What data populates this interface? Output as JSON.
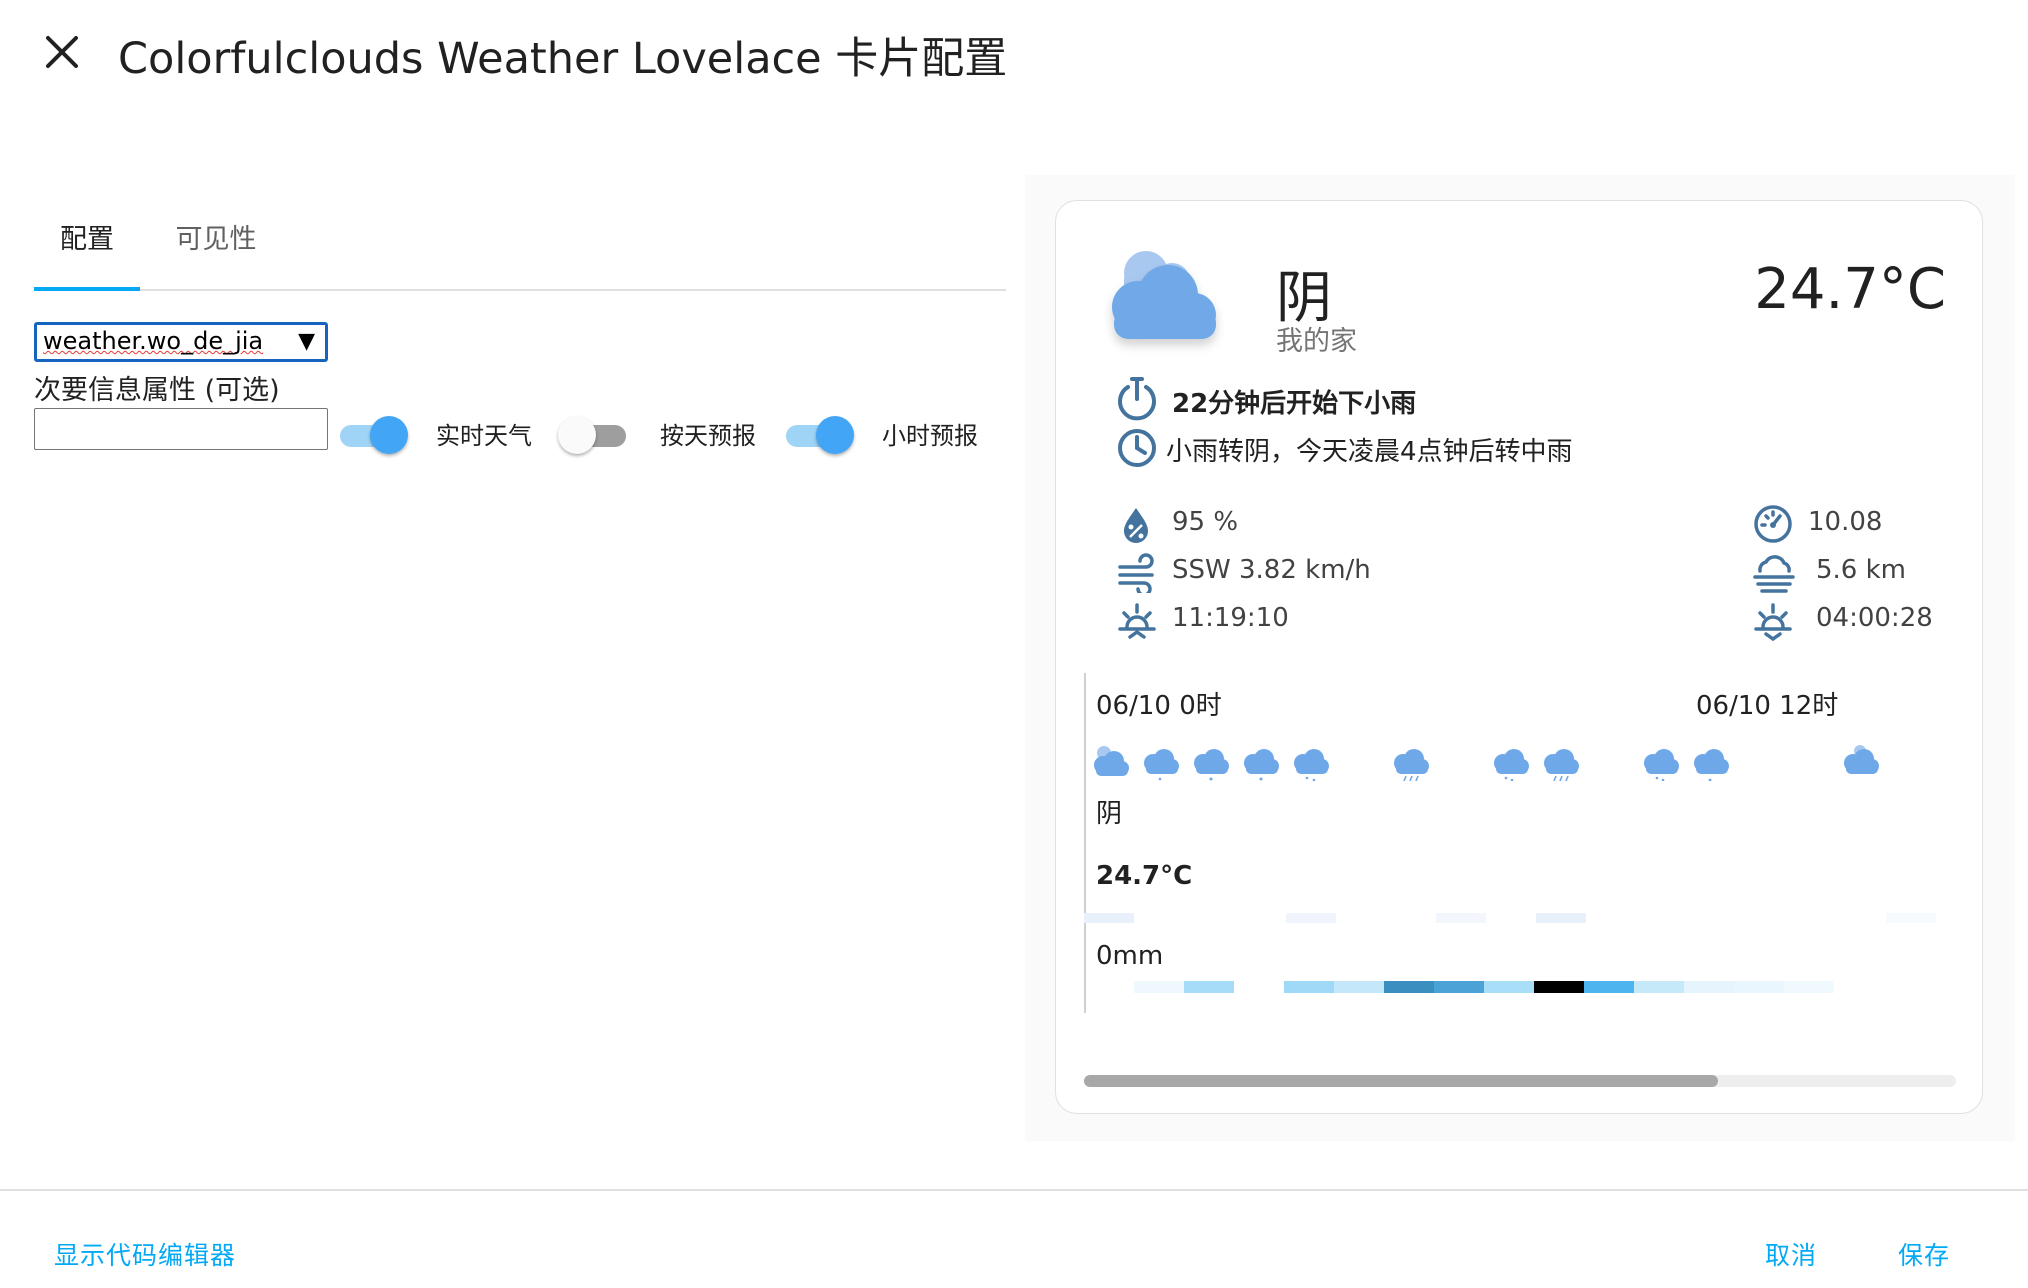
{
  "dialog": {
    "title": "Colorfulclouds Weather Lovelace 卡片配置",
    "close_icon": "close-icon"
  },
  "tabs": [
    {
      "label": "配置",
      "active": true
    },
    {
      "label": "可见性",
      "active": false
    }
  ],
  "config": {
    "entity_value": "weather.wo_de_jia",
    "secondary_label": "次要信息属性 (可选)",
    "secondary_value": "",
    "switches": [
      {
        "label": "实时天气",
        "on": true
      },
      {
        "label": "按天预报",
        "on": false
      },
      {
        "label": "小时预报",
        "on": true
      }
    ]
  },
  "preview": {
    "condition": "阴",
    "location": "我的家",
    "temperature": "24.7°C",
    "alerts": [
      {
        "icon": "timer-alert-icon",
        "text": "22分钟后开始下小雨"
      },
      {
        "icon": "clock-icon",
        "text": "小雨转阴，今天凌晨4点钟后转中雨"
      }
    ],
    "attributes_left": [
      {
        "icon": "humidity-icon",
        "text": "95 %"
      },
      {
        "icon": "wind-icon",
        "text": "SSW 3.82 km/h"
      },
      {
        "icon": "sunrise-icon",
        "text": "11:19:10"
      }
    ],
    "attributes_right": [
      {
        "icon": "gauge-icon",
        "text": "10.08"
      },
      {
        "icon": "visibility-icon",
        "text": "5.6 km"
      },
      {
        "icon": "sunset-icon",
        "text": "04:00:28"
      }
    ],
    "forecast": {
      "time_labels": [
        "06/10 0时",
        "06/10 12时"
      ],
      "condition": "阴",
      "temperature": "24.7°C",
      "precipitation": "0mm"
    },
    "colors": {
      "cloud": "#6fa8e8",
      "accent": "#03a9f4",
      "icon_gray": "#44739e"
    }
  },
  "footer": {
    "code_editor_label": "显示代码编辑器",
    "cancel_label": "取消",
    "save_label": "保存"
  }
}
